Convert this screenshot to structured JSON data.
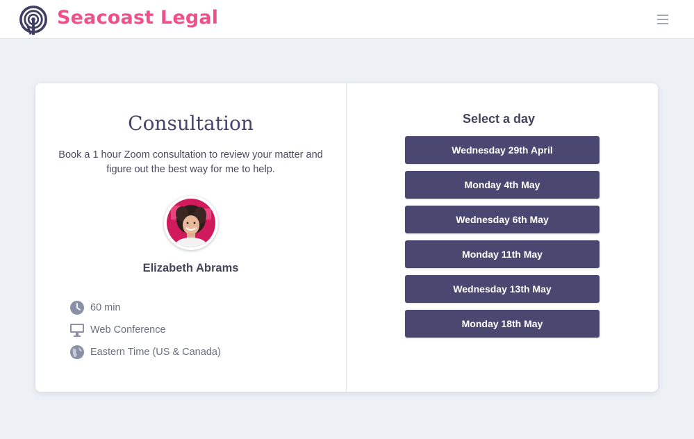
{
  "header": {
    "brand": "Seacoast Legal",
    "menu_icon": "hamburger-menu-icon",
    "logo_icon": "concentric-rings-logo-icon"
  },
  "event": {
    "title": "Consultation",
    "description": "Book a 1 hour Zoom consultation to review your matter and figure out the best way for me to help.",
    "host": "Elizabeth Abrams",
    "details": [
      {
        "icon": "clock-icon",
        "label": "60 min"
      },
      {
        "icon": "monitor-icon",
        "label": "Web Conference"
      },
      {
        "icon": "globe-icon",
        "label": "Eastern Time (US & Canada)"
      }
    ]
  },
  "schedule": {
    "heading": "Select a day",
    "days": [
      "Wednesday 29th April",
      "Monday 4th May",
      "Wednesday 6th May",
      "Monday 11th May",
      "Wednesday 13th May",
      "Monday 18th May"
    ]
  },
  "colors": {
    "brand": "#f0508a",
    "button": "#4a4870",
    "background": "#edf1f5"
  }
}
